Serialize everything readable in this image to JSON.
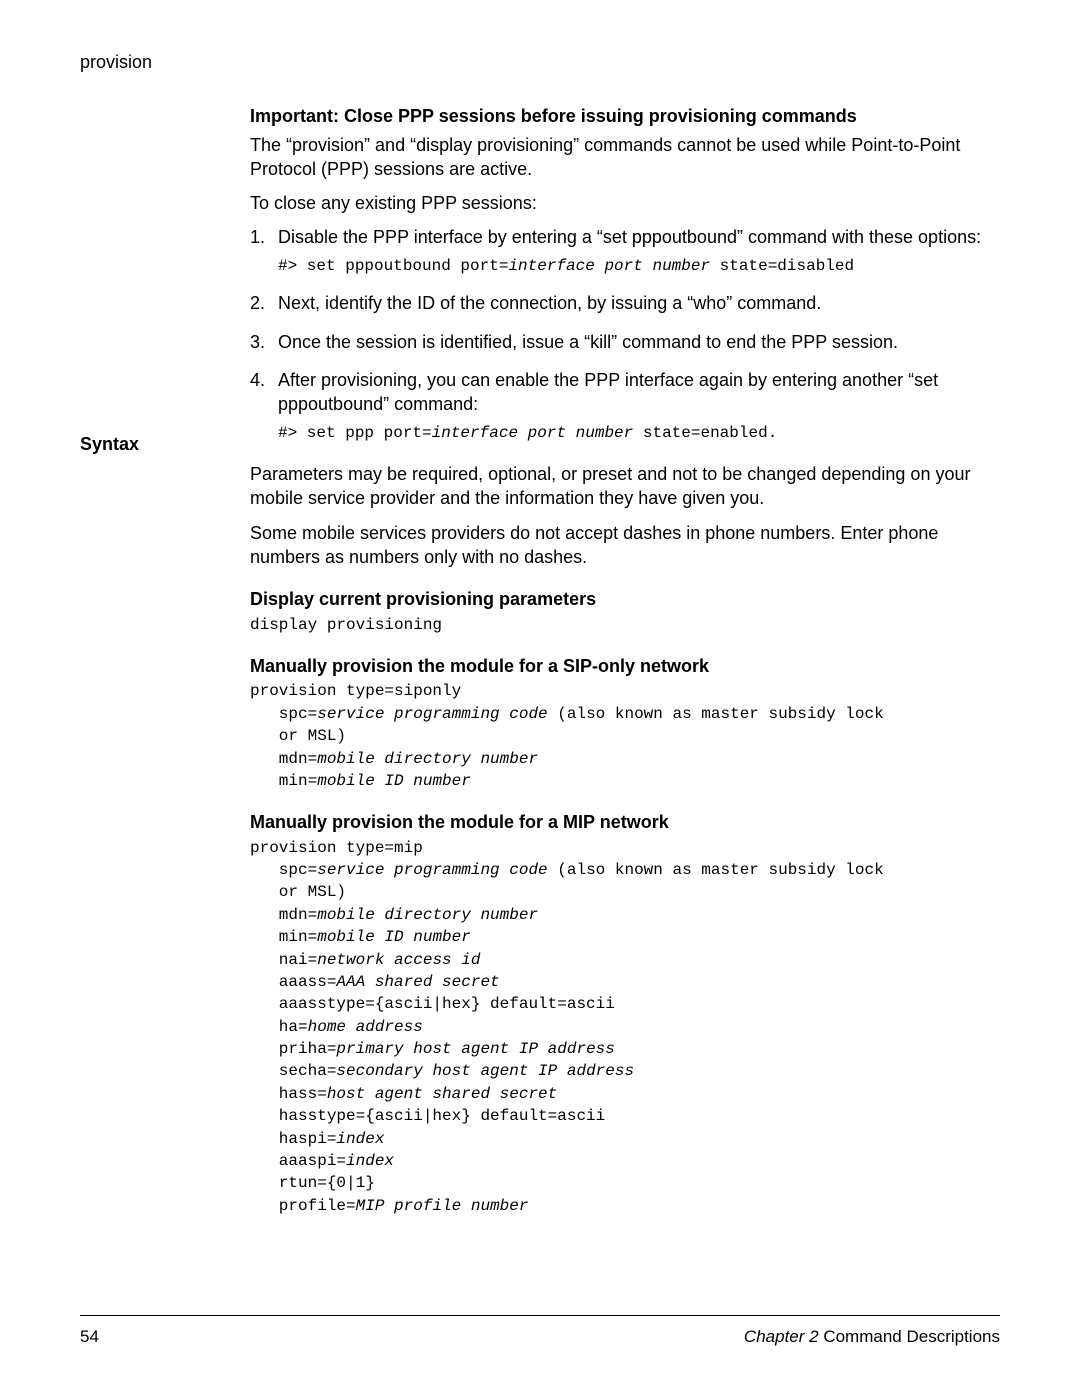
{
  "header": {
    "title": "provision"
  },
  "important": {
    "heading": "Important: Close PPP sessions before issuing provisioning commands",
    "p1": "The “provision” and “display provisioning” commands cannot be used while Point-to-Point Protocol (PPP) sessions are active.",
    "p2": "To close any existing PPP sessions:",
    "steps": {
      "s1_num": "1.",
      "s1_text": "Disable the PPP interface by entering a “set pppoutbound” command with these options:",
      "s1_code_a": "#> set pppoutbound port=",
      "s1_code_it": "interface port number",
      "s1_code_b": " state=disabled",
      "s2_num": "2.",
      "s2_text": "Next, identify the ID of the connection, by issuing a “who” command.",
      "s3_num": "3.",
      "s3_text": "Once the session is identified, issue a “kill” command to end the PPP session.",
      "s4_num": "4.",
      "s4_text": "After provisioning, you can enable the PPP interface again by entering another “set pppoutbound” command:",
      "s4_code_a": "#> set ppp port=",
      "s4_code_it": "interface port number",
      "s4_code_b": " state=enabled."
    }
  },
  "syntax": {
    "label": "Syntax",
    "p1": "Parameters may be required, optional, or preset and not to be changed depending on your mobile service provider and the information they have given you.",
    "p2": "Some mobile services providers do not accept dashes in phone numbers. Enter phone numbers as numbers only with no dashes.",
    "display": {
      "heading": "Display current provisioning parameters",
      "code": "display provisioning"
    },
    "sip": {
      "heading": "Manually provision the module for a SIP-only network",
      "l1": "provision type=siponly",
      "l2a": "   spc=",
      "l2it": "service programming code",
      "l2b": " (also known as master subsidy lock",
      "l3": "   or MSL)",
      "l4a": "   mdn=",
      "l4it": "mobile directory number",
      "l5a": "   min=",
      "l5it": "mobile ID number"
    },
    "mip": {
      "heading": "Manually provision the module for a MIP network",
      "l1": "provision type=mip",
      "l2a": "   spc=",
      "l2it": "service programming code",
      "l2b": " (also known as master subsidy lock",
      "l3": "   or MSL)",
      "l4a": "   mdn=",
      "l4it": "mobile directory number",
      "l5a": "   min=",
      "l5it": "mobile ID number",
      "l6a": "   nai=",
      "l6it": "network access id",
      "l7a": "   aaass=",
      "l7it": "AAA shared secret",
      "l8": "   aaasstype={ascii|hex} default=ascii",
      "l9a": "   ha=",
      "l9it": "home address",
      "l10a": "   priha=",
      "l10it": "primary host agent IP address",
      "l11a": "   secha=",
      "l11it": "secondary host agent IP address",
      "l12a": "   hass=",
      "l12it": "host agent shared secret",
      "l13": "   hasstype={ascii|hex} default=ascii",
      "l14a": "   haspi=",
      "l14it": "index",
      "l15a": "   aaaspi=",
      "l15it": "index",
      "l16": "   rtun={0|1}",
      "l17a": "   profile=",
      "l17it": "MIP profile number"
    }
  },
  "footer": {
    "page_number": "54",
    "chapter_it": "Chapter 2",
    "chapter_rest": "   Command Descriptions"
  }
}
